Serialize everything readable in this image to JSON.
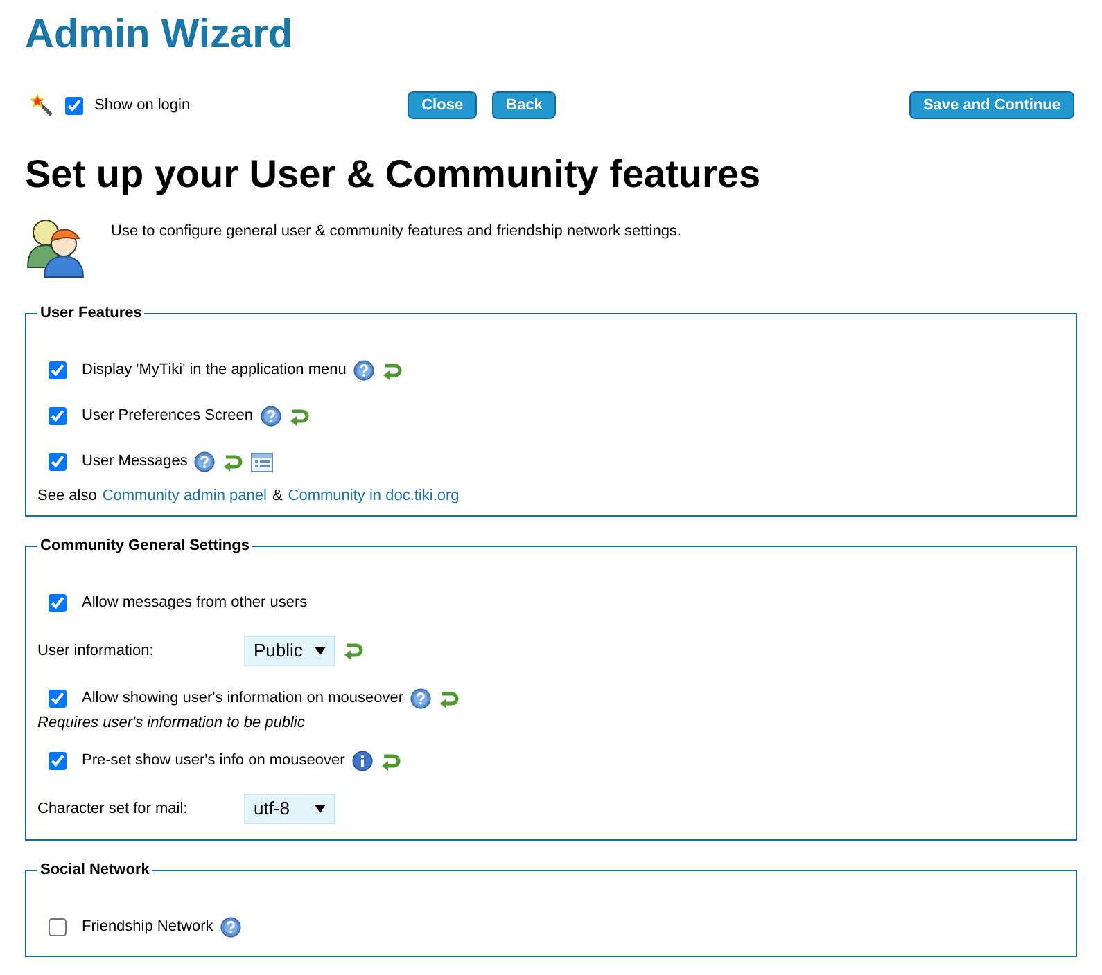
{
  "title": "Admin Wizard",
  "toolbar": {
    "show_on_login": {
      "label": "Show on login",
      "checked": true
    },
    "buttons": [
      "Close",
      "Back"
    ],
    "save_button": "Save and Continue"
  },
  "heading": "Set up your User & Community features",
  "intro": "Use to configure general user & community features and friendship network settings.",
  "sections": [
    {
      "legend": "User Features",
      "rows": [
        {
          "kind": "checkbox",
          "label": "Display 'MyTiki' in the application menu",
          "checked": true,
          "help": true,
          "reset": true
        },
        {
          "kind": "checkbox",
          "label": "User Preferences Screen",
          "checked": true,
          "help": true,
          "reset": true
        },
        {
          "kind": "checkbox",
          "label": "User Messages",
          "checked": true,
          "help": true,
          "reset": true,
          "panel": true
        },
        {
          "kind": "links",
          "text": "See also",
          "links": [
            "Community admin panel",
            "Community in doc.tiki.org"
          ],
          "joiner": "&"
        }
      ]
    },
    {
      "legend": "Community General Settings",
      "rows": [
        {
          "kind": "checkbox",
          "label": "Allow messages from other users",
          "checked": true
        },
        {
          "kind": "select",
          "label": "User information:",
          "value": "Public",
          "reset": true
        },
        {
          "kind": "checkbox",
          "label": "Allow showing user's information on mouseover",
          "checked": true,
          "help": true,
          "reset": true
        },
        {
          "kind": "note",
          "text": "Requires user's information to be public"
        },
        {
          "kind": "checkbox",
          "label": "Pre-set show user's info on mouseover",
          "checked": true,
          "info": true,
          "reset": true
        },
        {
          "kind": "select",
          "label": "Character set for mail:",
          "value": "utf-8"
        }
      ]
    },
    {
      "legend": "Social Network",
      "rows": [
        {
          "kind": "checkbox",
          "label": "Friendship Network",
          "checked": false,
          "help": true
        }
      ]
    }
  ]
}
